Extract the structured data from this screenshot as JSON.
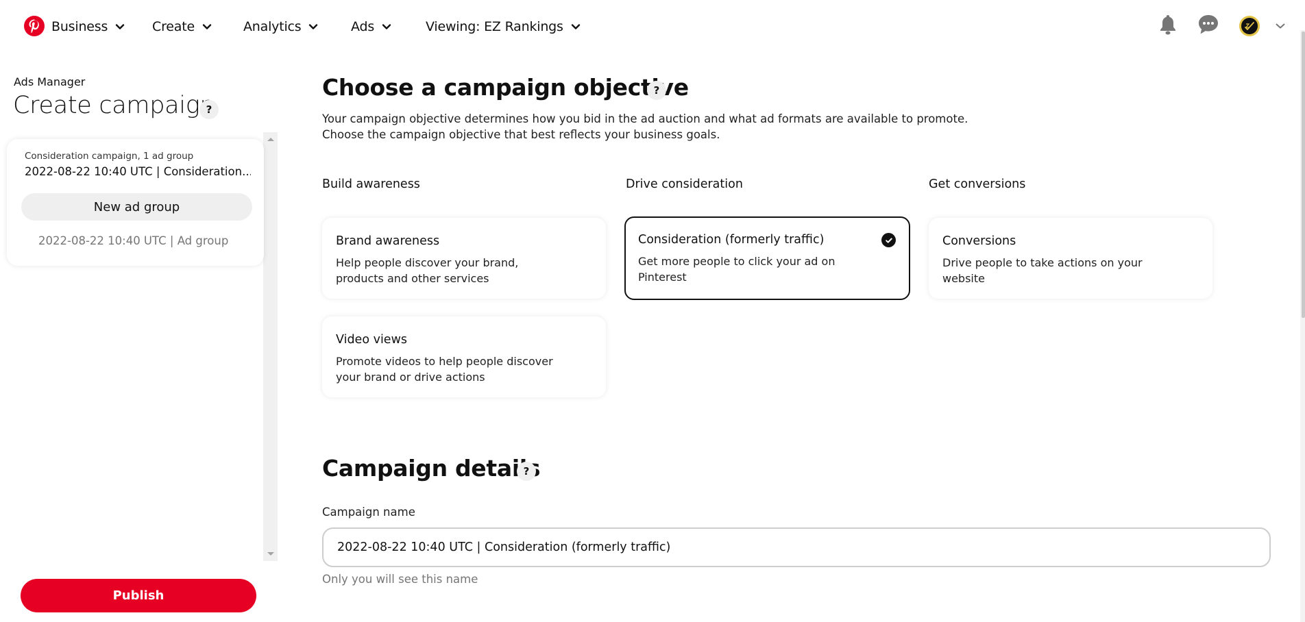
{
  "nav": {
    "logo": "pinterest-logo",
    "items": [
      {
        "label": "Business",
        "icon": "chevron-down-icon"
      },
      {
        "label": "Create",
        "icon": "chevron-down-icon"
      },
      {
        "label": "Analytics",
        "icon": "chevron-down-icon"
      },
      {
        "label": "Ads",
        "icon": "chevron-down-icon"
      },
      {
        "label": "Viewing: EZ Rankings",
        "icon": "chevron-down-icon"
      }
    ],
    "right_icons": [
      "bell-icon",
      "chat-icon",
      "avatar",
      "chevron-down-icon"
    ],
    "colors": {
      "brand": "#e60023",
      "icon_gray": "#767676",
      "avatar_ring": "#e3c447"
    }
  },
  "sidebar": {
    "section": "Ads Manager",
    "title": "Create campaign",
    "help": "?",
    "campaign_card": {
      "subtitle": "Consideration campaign, 1 ad group",
      "campaign_name": "2022-08-22 10:40 UTC | Consideration...",
      "new_ad_group_label": "New ad group",
      "ad_group_name": "2022-08-22 10:40 UTC | Ad group"
    },
    "publish_label": "Publish"
  },
  "main": {
    "objective": {
      "title": "Choose a campaign objective",
      "help": "?",
      "description_line1": "Your campaign objective determines how you bid in the ad auction and what ad formats are available to promote.",
      "description_line2": "Choose the campaign objective that best reflects your business goals.",
      "columns": [
        {
          "heading": "Build awareness",
          "cards": [
            {
              "title": "Brand awareness",
              "description": "Help people discover your brand, products and other services",
              "selected": false
            },
            {
              "title": "Video views",
              "description": "Promote videos to help people discover your brand or drive actions",
              "selected": false
            }
          ]
        },
        {
          "heading": "Drive consideration",
          "cards": [
            {
              "title": "Consideration (formerly traffic)",
              "description": "Get more people to click your ad on Pinterest",
              "selected": true
            }
          ]
        },
        {
          "heading": "Get conversions",
          "cards": [
            {
              "title": "Conversions",
              "description": "Drive people to take actions on your website",
              "selected": false
            }
          ]
        }
      ]
    },
    "details": {
      "title": "Campaign details",
      "help": "?",
      "campaign_name_label": "Campaign name",
      "campaign_name_value": "2022-08-22 10:40 UTC | Consideration (formerly traffic)",
      "campaign_name_help": "Only you will see this name"
    }
  }
}
